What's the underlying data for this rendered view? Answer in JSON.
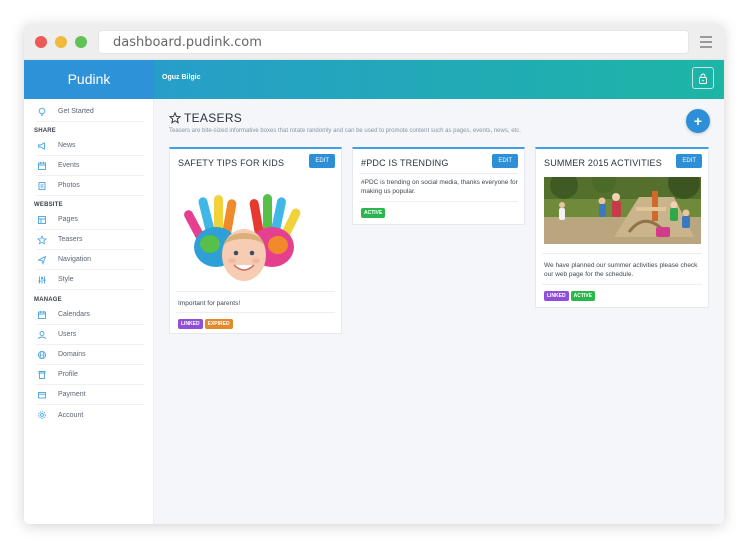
{
  "browser": {
    "url": "dashboard.pudink.com"
  },
  "app": {
    "brand": "Pudink",
    "username": "Oguz Bilgic"
  },
  "sidebar": {
    "get_started": "Get Started",
    "sections": {
      "share": "SHARE",
      "website": "WEBSITE",
      "manage": "MANAGE"
    },
    "share_items": [
      {
        "label": "News",
        "icon": "megaphone-icon"
      },
      {
        "label": "Events",
        "icon": "calendar-icon"
      },
      {
        "label": "Photos",
        "icon": "photo-icon"
      }
    ],
    "website_items": [
      {
        "label": "Pages",
        "icon": "pages-icon"
      },
      {
        "label": "Teasers",
        "icon": "star-icon"
      },
      {
        "label": "Navigation",
        "icon": "navigation-icon"
      },
      {
        "label": "Style",
        "icon": "sliders-icon"
      }
    ],
    "manage_items": [
      {
        "label": "Calendars",
        "icon": "calendar-icon"
      },
      {
        "label": "Users",
        "icon": "user-icon"
      },
      {
        "label": "Domains",
        "icon": "globe-icon"
      },
      {
        "label": "Profile",
        "icon": "profile-icon"
      },
      {
        "label": "Payment",
        "icon": "payment-icon"
      },
      {
        "label": "Account",
        "icon": "gear-icon"
      }
    ]
  },
  "page": {
    "title": "TEASERS",
    "description": "Teasers are bite-sized informative boxes that rotate randomly and can be used to promote content such as pages, events, news, etc.",
    "add_label": "+"
  },
  "cards": [
    {
      "title": "SAFETY TIPS FOR KIDS",
      "edit": "EDIT",
      "body": "Important for parents!",
      "badges": [
        "LINKED",
        "EXPIRED"
      ]
    },
    {
      "title": "#PDC IS TRENDING",
      "edit": "EDIT",
      "body": "#PDC is trending on social media, thanks everyone for making us popular.",
      "badges": [
        "ACTIVE"
      ]
    },
    {
      "title": "SUMMER 2015 ACTIVITIES",
      "edit": "EDIT",
      "body": "We have planned our summer activities please check our web page for the schedule.",
      "badges": [
        "LINKED",
        "ACTIVE"
      ]
    }
  ],
  "colors": {
    "brand_blue": "#2e92d9",
    "gradient_end": "#1db5a6",
    "linked": "#8f4fd9",
    "expired": "#e38a2b",
    "active": "#2bb54d"
  }
}
